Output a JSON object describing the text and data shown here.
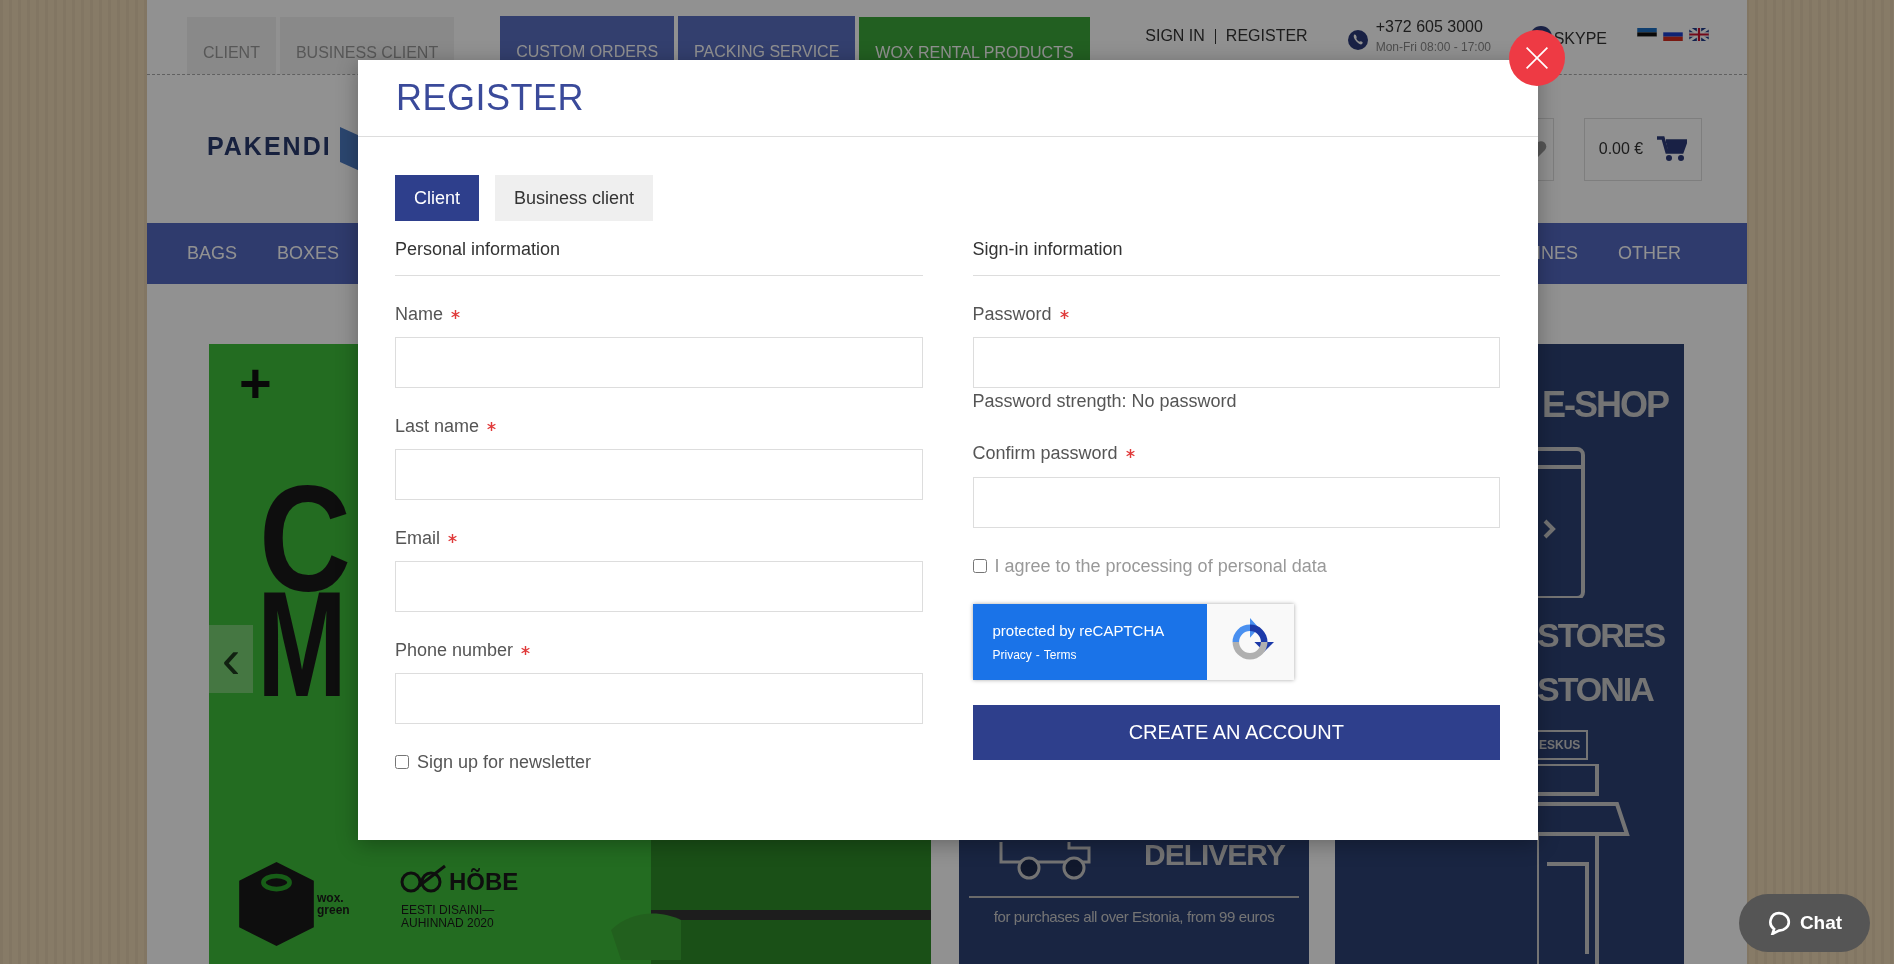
{
  "top_bar": {
    "tabs": [
      {
        "label": "CLIENT",
        "kind": "plain"
      },
      {
        "label": "BUSINESS CLIENT",
        "kind": "plain"
      },
      {
        "label": "CUSTOM ORDERS",
        "kind": "blue"
      },
      {
        "label": "PACKING SERVICE",
        "kind": "blue"
      },
      {
        "label": "WOX RENTAL PRODUCTS",
        "kind": "green"
      }
    ],
    "sign_in": "SIGN IN",
    "register": "REGISTER",
    "phone": "+372 605 3000",
    "hours": "Mon-Fri 08:00 - 17:00",
    "skype": "SKYPE"
  },
  "header": {
    "logo": "PAKENDI",
    "cart_total": "0.00 €"
  },
  "nav": {
    "left": [
      "BAGS",
      "BOXES"
    ],
    "right": [
      "INES",
      "OTHER"
    ]
  },
  "banners": {
    "green": {
      "plus": "+",
      "big_letters": [
        "C",
        "M"
      ],
      "prev": "‹",
      "wox_tagline": "wox. green",
      "award": "HÕBE",
      "award_caption": "EESTI DISAINI— AUHINNAD 2020"
    },
    "delivery": {
      "heading": "DELIVERY",
      "caption": "for purchases all over Estonia, from 99 euros"
    },
    "shop": {
      "heading": "E-SHOP",
      "lines": [
        "STORES",
        "STONIA"
      ],
      "sign": "ESKUS"
    }
  },
  "modal": {
    "title": "REGISTER",
    "tabs": [
      {
        "label": "Client",
        "selected": true
      },
      {
        "label": "Business client",
        "selected": false
      }
    ],
    "personal": {
      "title": "Personal information",
      "fields": [
        {
          "label": "Name",
          "required": true
        },
        {
          "label": "Last name",
          "required": true
        },
        {
          "label": "Email",
          "required": true
        },
        {
          "label": "Phone number",
          "required": true
        }
      ],
      "newsletter": {
        "label": "Sign up for newsletter",
        "checked": false
      }
    },
    "signin": {
      "title": "Sign-in information",
      "password": {
        "label": "Password",
        "required": true
      },
      "strength": "Password strength: No password",
      "confirm": {
        "label": "Confirm password",
        "required": true
      },
      "agree": {
        "label": "I agree to the processing of personal data",
        "checked": false
      },
      "recaptcha": {
        "text": "protected by reCAPTCHA",
        "privacy": "Privacy",
        "separator": "-",
        "terms": "Terms"
      },
      "button": "CREATE AN ACCOUNT"
    }
  },
  "chat": "Chat"
}
